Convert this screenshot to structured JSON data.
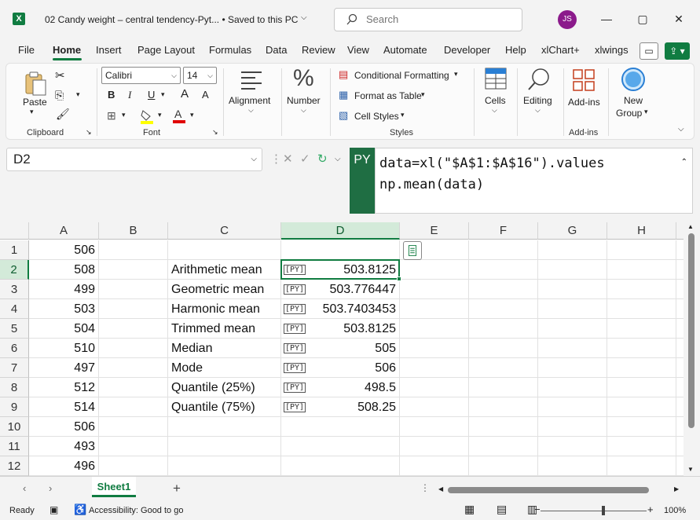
{
  "app": {
    "icon_letter": "X",
    "doc_title": "02 Candy weight – central tendency-Pyt... • Saved to this PC",
    "search_placeholder": "Search",
    "avatar_initials": "JS"
  },
  "tabs": [
    "File",
    "Home",
    "Insert",
    "Page Layout",
    "Formulas",
    "Data",
    "Review",
    "View",
    "Automate",
    "Developer",
    "Help",
    "xlChart+",
    "xlwings"
  ],
  "active_tab": "Home",
  "ribbon": {
    "clipboard": {
      "paste_label": "Paste",
      "group_label": "Clipboard"
    },
    "font": {
      "font_name": "Calibri",
      "font_size": "14",
      "group_label": "Font",
      "bold": "B",
      "italic": "I",
      "underline": "U",
      "grow": "A",
      "shrink": "A"
    },
    "alignment": {
      "label": "Alignment"
    },
    "number": {
      "label": "Number",
      "symbol": "%"
    },
    "styles": {
      "conditional_formatting": "Conditional Formatting",
      "format_as_table": "Format as Table",
      "cell_styles": "Cell Styles",
      "group_label": "Styles"
    },
    "cells": {
      "label": "Cells"
    },
    "editing": {
      "label": "Editing"
    },
    "addins": {
      "button_label": "Add-ins",
      "group_label": "Add-ins"
    },
    "new_group": {
      "label_line1": "New",
      "label_line2": "Group"
    }
  },
  "formula_bar": {
    "name_box": "D2",
    "py_badge": "PY",
    "line1": "data=xl(\"$A$1:$A$16\").values",
    "line2": "np.mean(data)"
  },
  "grid": {
    "columns": [
      "A",
      "B",
      "C",
      "D",
      "E",
      "F",
      "G",
      "H"
    ],
    "rows": [
      {
        "n": "1",
        "a": "506",
        "c": "",
        "d": ""
      },
      {
        "n": "2",
        "a": "508",
        "c": "Arithmetic mean",
        "d": "503.8125"
      },
      {
        "n": "3",
        "a": "499",
        "c": "Geometric mean",
        "d": "503.776447"
      },
      {
        "n": "4",
        "a": "503",
        "c": "Harmonic mean",
        "d": "503.7403453"
      },
      {
        "n": "5",
        "a": "504",
        "c": "Trimmed mean",
        "d": "503.8125"
      },
      {
        "n": "6",
        "a": "510",
        "c": "Median",
        "d": "505"
      },
      {
        "n": "7",
        "a": "497",
        "c": "Mode",
        "d": "506"
      },
      {
        "n": "8",
        "a": "512",
        "c": "Quantile (25%)",
        "d": "498.5"
      },
      {
        "n": "9",
        "a": "514",
        "c": "Quantile (75%)",
        "d": "508.25"
      },
      {
        "n": "10",
        "a": "506",
        "c": "",
        "d": ""
      },
      {
        "n": "11",
        "a": "493",
        "c": "",
        "d": ""
      },
      {
        "n": "12",
        "a": "496",
        "c": "",
        "d": ""
      }
    ],
    "py_icon_text": "[PY]"
  },
  "sheets": {
    "active": "Sheet1",
    "add": "+"
  },
  "status": {
    "ready": "Ready",
    "accessibility": "Accessibility: Good to go",
    "zoom": "100%"
  }
}
